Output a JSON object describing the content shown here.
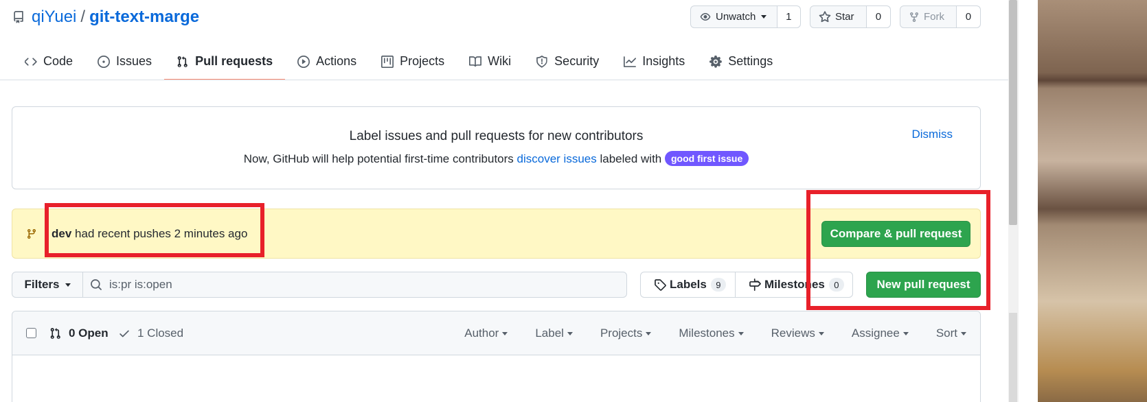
{
  "repo": {
    "owner": "qiYuei",
    "separator": "/",
    "name": "git-text-marge"
  },
  "header_buttons": {
    "watch": {
      "label": "Unwatch",
      "count": "1"
    },
    "star": {
      "label": "Star",
      "count": "0"
    },
    "fork": {
      "label": "Fork",
      "count": "0"
    }
  },
  "tabs": [
    {
      "label": "Code",
      "icon": "code-icon"
    },
    {
      "label": "Issues",
      "icon": "issue-opened-icon"
    },
    {
      "label": "Pull requests",
      "icon": "git-pull-request-icon",
      "active": true
    },
    {
      "label": "Actions",
      "icon": "play-icon"
    },
    {
      "label": "Projects",
      "icon": "table-icon"
    },
    {
      "label": "Wiki",
      "icon": "book-icon"
    },
    {
      "label": "Security",
      "icon": "shield-icon"
    },
    {
      "label": "Insights",
      "icon": "graph-icon"
    },
    {
      "label": "Settings",
      "icon": "gear-icon"
    }
  ],
  "banner": {
    "title": "Label issues and pull requests for new contributors",
    "text_before": "Now, GitHub will help potential first-time contributors",
    "link": "discover issues",
    "text_after": "labeled with",
    "pill": "good first issue",
    "dismiss": "Dismiss"
  },
  "recent_push": {
    "branch": "dev",
    "text": "had recent pushes 2 minutes ago",
    "button": "Compare & pull request"
  },
  "filter_bar": {
    "filters_label": "Filters",
    "search_value": "is:pr is:open",
    "labels_label": "Labels",
    "labels_count": "9",
    "milestones_label": "Milestones",
    "milestones_count": "0",
    "new_pr_label": "New pull request"
  },
  "list_header": {
    "open_label": "0 Open",
    "closed_label": "1 Closed",
    "menus": [
      "Author",
      "Label",
      "Projects",
      "Milestones",
      "Reviews",
      "Assignee",
      "Sort"
    ]
  },
  "colors": {
    "primary_button": "#2da44e",
    "link": "#0969da",
    "annotation": "#e8202a",
    "pill": "#7057ff",
    "push_bg": "#fff8c5"
  }
}
